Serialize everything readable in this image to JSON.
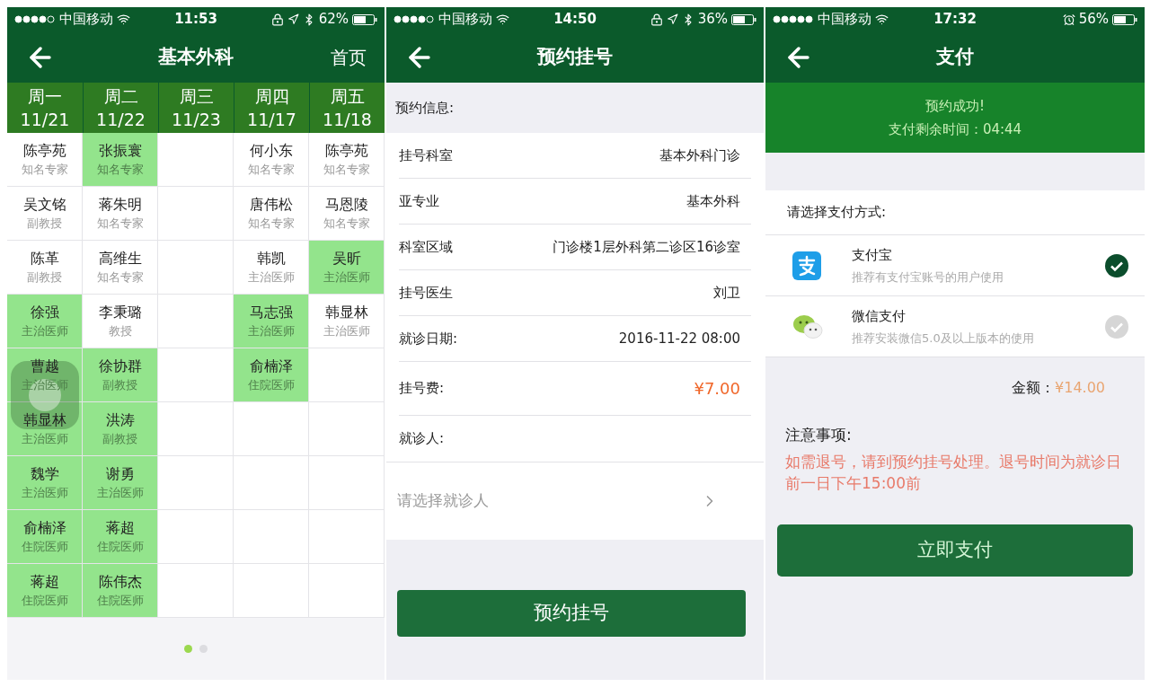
{
  "screens": [
    {
      "status_bar": {
        "carrier": "中国移动",
        "time": "11:53",
        "battery": "62%",
        "rotation_lock": true,
        "location": true,
        "bluetooth": true
      },
      "nav": {
        "title": "基本外科",
        "right_action": "首页"
      },
      "schedule": {
        "columns": [
          {
            "day": "周一",
            "date": "11/21"
          },
          {
            "day": "周二",
            "date": "11/22"
          },
          {
            "day": "周三",
            "date": "11/23"
          },
          {
            "day": "周四",
            "date": "11/17"
          },
          {
            "day": "周五",
            "date": "11/18"
          }
        ],
        "rows": [
          [
            {
              "name": "陈亭苑",
              "title": "知名专家",
              "highlighted": false
            },
            {
              "name": "张振寰",
              "title": "知名专家",
              "highlighted": true
            },
            null,
            {
              "name": "何小东",
              "title": "知名专家",
              "highlighted": false
            },
            {
              "name": "陈亭苑",
              "title": "知名专家",
              "highlighted": false
            }
          ],
          [
            {
              "name": "吴文铭",
              "title": "副教授",
              "highlighted": false
            },
            {
              "name": "蒋朱明",
              "title": "知名专家",
              "highlighted": false
            },
            null,
            {
              "name": "唐伟松",
              "title": "知名专家",
              "highlighted": false
            },
            {
              "name": "马恩陵",
              "title": "知名专家",
              "highlighted": false
            }
          ],
          [
            {
              "name": "陈革",
              "title": "副教授",
              "highlighted": false
            },
            {
              "name": "高维生",
              "title": "知名专家",
              "highlighted": false
            },
            null,
            {
              "name": "韩凯",
              "title": "主治医师",
              "highlighted": false
            },
            {
              "name": "吴昕",
              "title": "主治医师",
              "highlighted": true
            }
          ],
          [
            {
              "name": "徐强",
              "title": "主治医师",
              "highlighted": true
            },
            {
              "name": "李秉璐",
              "title": "教授",
              "highlighted": false
            },
            null,
            {
              "name": "马志强",
              "title": "主治医师",
              "highlighted": true
            },
            {
              "name": "韩显林",
              "title": "主治医师",
              "highlighted": false
            }
          ],
          [
            {
              "name": "曹越",
              "title": "主治医师",
              "highlighted": true
            },
            {
              "name": "徐协群",
              "title": "副教授",
              "highlighted": true
            },
            null,
            {
              "name": "俞楠泽",
              "title": "住院医师",
              "highlighted": true
            },
            null
          ],
          [
            {
              "name": "韩显林",
              "title": "主治医师",
              "highlighted": true
            },
            {
              "name": "洪涛",
              "title": "副教授",
              "highlighted": true
            },
            null,
            null,
            null
          ],
          [
            {
              "name": "魏学",
              "title": "主治医师",
              "highlighted": true
            },
            {
              "name": "谢勇",
              "title": "主治医师",
              "highlighted": true
            },
            null,
            null,
            null
          ],
          [
            {
              "name": "俞楠泽",
              "title": "住院医师",
              "highlighted": true
            },
            {
              "name": "蒋超",
              "title": "住院医师",
              "highlighted": true
            },
            null,
            null,
            null
          ],
          [
            {
              "name": "蒋超",
              "title": "住院医师",
              "highlighted": true
            },
            {
              "name": "陈伟杰",
              "title": "住院医师",
              "highlighted": true
            },
            null,
            null,
            null
          ]
        ]
      },
      "page_dots": [
        {
          "selected": true
        },
        {
          "selected": false
        }
      ],
      "assistive_touch": true
    },
    {
      "status_bar": {
        "carrier": "中国移动",
        "time": "14:50",
        "battery": "36%",
        "rotation_lock": true,
        "location": true,
        "bluetooth": true
      },
      "nav": {
        "title": "预约挂号"
      },
      "section_title": "预约信息:",
      "fields": [
        {
          "label": "挂号科室",
          "value": "基本外科门诊",
          "emphasis": false
        },
        {
          "label": "亚专业",
          "value": "基本外科",
          "emphasis": false
        },
        {
          "label": "科室区域",
          "value": "门诊楼1层外科第二诊区16诊室",
          "emphasis": false
        },
        {
          "label": "挂号医生",
          "value": "刘卫",
          "emphasis": false
        },
        {
          "label": "就诊日期:",
          "value": "2016-11-22 08:00",
          "emphasis": false
        },
        {
          "label": "挂号费:",
          "value": "¥7.00",
          "emphasis": true
        }
      ],
      "patient_label": "就诊人:",
      "patient_picker": {
        "placeholder": "请选择就诊人"
      },
      "submit_button": "预约挂号"
    },
    {
      "status_bar": {
        "carrier": "中国移动",
        "time": "17:32",
        "battery": "56%",
        "alarm": true
      },
      "nav": {
        "title": "支付"
      },
      "banner": {
        "message": "预约成功!",
        "countdown": "支付剩余时间：04:44"
      },
      "methods_title": "请选择支付方式:",
      "methods": [
        {
          "kind": "alipay",
          "name": "支付宝",
          "description": "推荐有支付宝账号的用户使用",
          "selected": true
        },
        {
          "kind": "wechat",
          "name": "微信支付",
          "description": "推荐安装微信5.0及以上版本的使用",
          "selected": false
        }
      ],
      "amount_label": "金额：",
      "amount": "¥14.00",
      "notice_title": "注意事项:",
      "notice": "如需退号，请到预约挂号处理。退号时间为就诊日前一日下午15:00前",
      "pay_button": "立即支付"
    }
  ]
}
